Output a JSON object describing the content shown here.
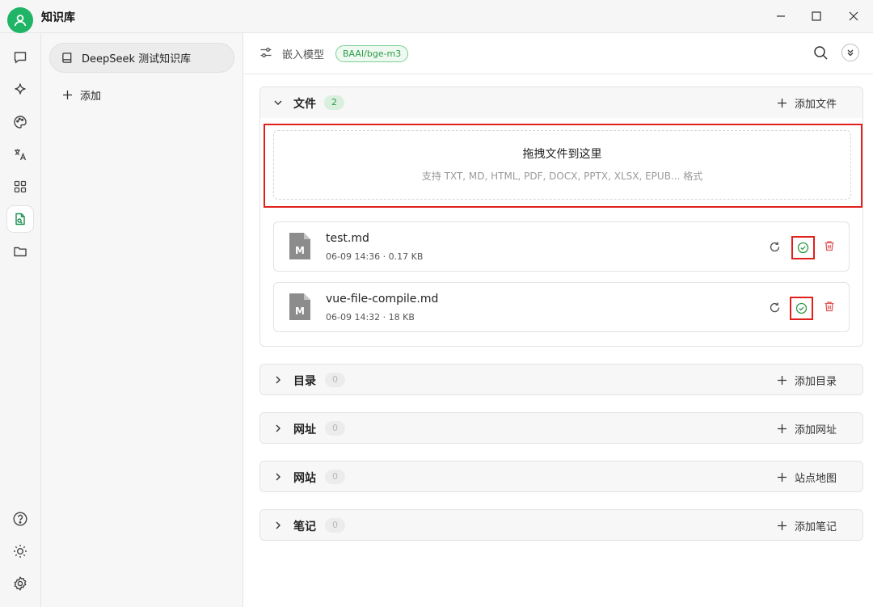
{
  "app": {
    "title": "知识库"
  },
  "sidebar": {
    "knowledge_bases": [
      {
        "label": "DeepSeek 测试知识库"
      }
    ],
    "add_label": "添加"
  },
  "header": {
    "embed_label": "嵌入模型",
    "model_tag": "BAAI/bge-m3"
  },
  "sections": {
    "files": {
      "title": "文件",
      "count": "2",
      "action": "添加文件",
      "dropzone": {
        "title": "拖拽文件到这里",
        "hint": "支持 TXT, MD, HTML, PDF, DOCX, PPTX, XLSX, EPUB... 格式"
      },
      "items": [
        {
          "name": "test.md",
          "meta": "06-09 14:36 · 0.17 KB"
        },
        {
          "name": "vue-file-compile.md",
          "meta": "06-09 14:32 · 18 KB"
        }
      ]
    },
    "directories": {
      "title": "目录",
      "count": "0",
      "action": "添加目录"
    },
    "urls": {
      "title": "网址",
      "count": "0",
      "action": "添加网址"
    },
    "websites": {
      "title": "网站",
      "count": "0",
      "action": "站点地图"
    },
    "notes": {
      "title": "笔记",
      "count": "0",
      "action": "添加笔记"
    }
  },
  "colors": {
    "accent": "#1fb466",
    "highlight": "#e0201b",
    "success": "#2f9a48",
    "danger": "#e05a5a"
  },
  "icons": {
    "rail_top": [
      "chat-icon",
      "sparkle-icon",
      "palette-icon",
      "translate-icon",
      "apps-icon",
      "knowledge-icon",
      "folder-icon"
    ],
    "rail_bottom": [
      "help-icon",
      "theme-icon",
      "settings-icon"
    ]
  }
}
